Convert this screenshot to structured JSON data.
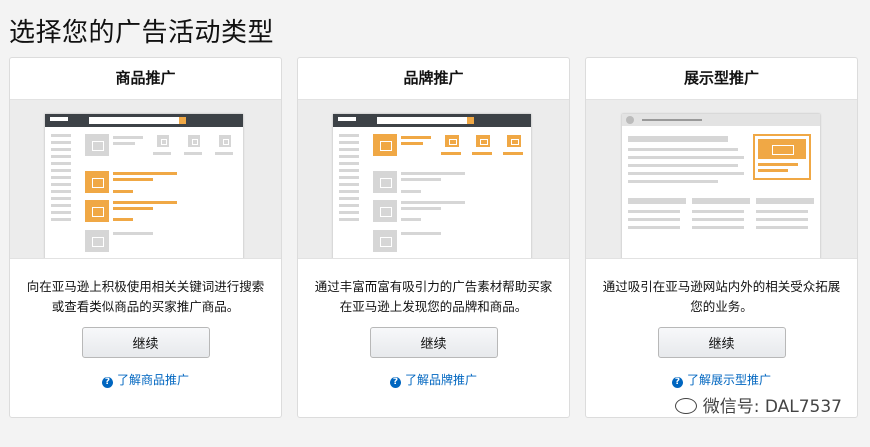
{
  "page": {
    "title": "选择您的广告活动类型"
  },
  "cards": [
    {
      "title": "商品推广",
      "description": "向在亚马逊上积极使用相关关键词进行搜索或查看类似商品的买家推广商品。",
      "button": "继续",
      "link": "了解商品推广"
    },
    {
      "title": "品牌推广",
      "description": "通过丰富而富有吸引力的广告素材帮助买家在亚马逊上发现您的品牌和商品。",
      "button": "继续",
      "link": "了解品牌推广"
    },
    {
      "title": "展示型推广",
      "description": "通过吸引在亚马逊网站内外的相关受众拓展您的业务。",
      "button": "继续",
      "link": "了解展示型推广"
    }
  ],
  "watermark": "微信号: DAL7537",
  "colors": {
    "accent": "#f0a845",
    "link": "#0066c0",
    "mockHeader": "#3d4247"
  }
}
